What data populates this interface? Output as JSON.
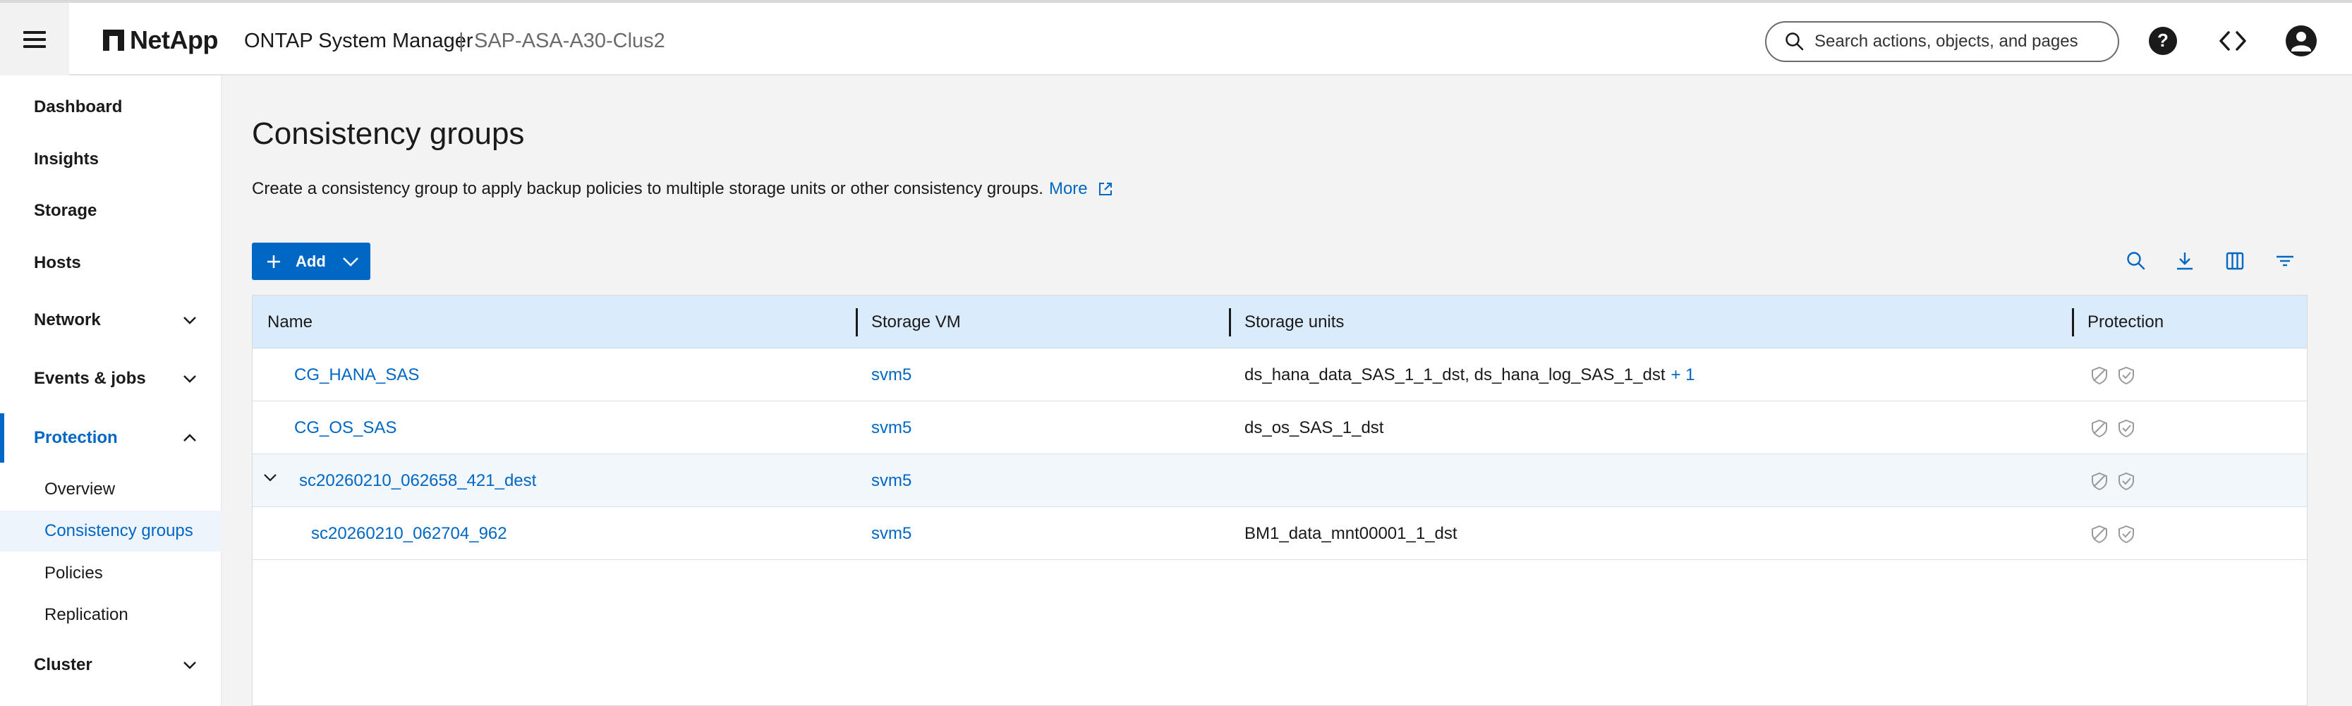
{
  "header": {
    "logo_text": "NetApp",
    "app_title": "ONTAP System Manager",
    "separator": "|",
    "cluster_name": "SAP-ASA-A30-Clus2",
    "search_placeholder": "Search actions, objects, and pages",
    "icons": [
      "menu-icon",
      "search-icon",
      "help-icon",
      "code-icon",
      "user-icon"
    ]
  },
  "sidebar": {
    "items": [
      {
        "label": "Dashboard"
      },
      {
        "label": "Insights"
      },
      {
        "label": "Storage"
      },
      {
        "label": "Hosts"
      },
      {
        "label": "Network",
        "expandable": true
      },
      {
        "label": "Events & jobs",
        "expandable": true
      },
      {
        "label": "Protection",
        "expandable": true,
        "expanded": true,
        "active": true
      },
      {
        "label": "Cluster",
        "expandable": true
      }
    ],
    "protection_sub": [
      {
        "label": "Overview"
      },
      {
        "label": "Consistency groups",
        "active": true
      },
      {
        "label": "Policies"
      },
      {
        "label": "Replication"
      }
    ]
  },
  "main": {
    "title": "Consistency groups",
    "description": "Create a consistency group to apply backup policies to multiple storage units or other consistency groups.",
    "more_link": "More",
    "add_button": "Add",
    "toolbar_icons": [
      "search-icon",
      "download-icon",
      "columns-icon",
      "filter-icon"
    ]
  },
  "table": {
    "columns": [
      "Name",
      "Storage VM",
      "Storage units",
      "Protection"
    ],
    "rows": [
      {
        "name": "CG_HANA_SAS",
        "svm": "svm5",
        "units": "ds_hana_data_SAS_1_1_dst, ds_hana_log_SAS_1_dst",
        "more": "+ 1"
      },
      {
        "name": "CG_OS_SAS",
        "svm": "svm5",
        "units": "ds_os_SAS_1_dst",
        "more": ""
      },
      {
        "name": "sc20260210_062658_421_dest",
        "svm": "svm5",
        "units": "",
        "more": "",
        "expanded": true
      },
      {
        "name": "sc20260210_062704_962",
        "svm": "svm5",
        "units": "BM1_data_mnt00001_1_dst",
        "more": "",
        "child": true
      }
    ]
  },
  "colors": {
    "accent": "#0067c5",
    "header_row": "#daecfb",
    "main_bg": "#f3f3f3",
    "icon_grey": "#9a9a9a"
  }
}
